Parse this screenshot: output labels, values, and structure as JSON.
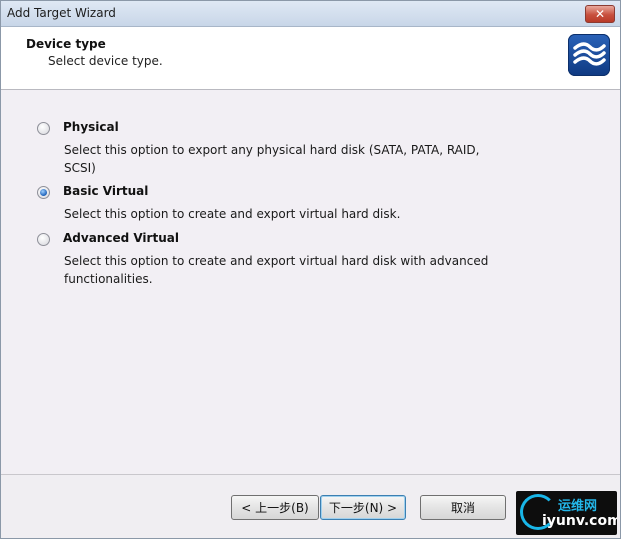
{
  "window": {
    "title": "Add Target Wizard",
    "close_symbol": "✕"
  },
  "header": {
    "title": "Device type",
    "subtitle": "Select device type.",
    "logo_icon": "waves-logo-icon"
  },
  "options": [
    {
      "label": "Physical",
      "description": "Select this option to export any physical hard disk (SATA, PATA, RAID, SCSI)",
      "selected": false
    },
    {
      "label": "Basic Virtual",
      "description": "Select this option to create and export virtual hard disk.",
      "selected": true
    },
    {
      "label": "Advanced Virtual",
      "description": "Select this option to create and export virtual hard disk with advanced functionalities.",
      "selected": false
    }
  ],
  "footer": {
    "back_label": "< 上一步(B)",
    "next_label": "下一步(N) >",
    "cancel_label": "取消"
  },
  "watermark": {
    "cn_text": "运维网",
    "en_text": "iyunv.com"
  },
  "colors": {
    "accent": "#1b5fb8",
    "title_bar": "#c8d6e8",
    "close_button": "#c8503e"
  }
}
